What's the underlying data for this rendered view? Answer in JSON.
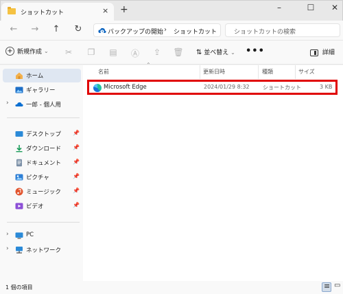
{
  "window": {
    "tab_title": "ショットカット",
    "close_tab_glyph": "×",
    "new_tab_glyph": "+",
    "minimize_glyph": "–",
    "maximize_glyph": "☐",
    "close_glyph": "✕"
  },
  "nav": {
    "back_glyph": "←",
    "forward_glyph": "→",
    "up_glyph": "↑",
    "refresh_glyph": "↻",
    "breadcrumbs": [
      "バックアップの開始",
      "ショットカット"
    ],
    "search_placeholder": "ショットカットの検索"
  },
  "toolbar": {
    "new_label": "新規作成",
    "sort_label": "並べ替え",
    "more_glyph": "•••",
    "details_label": "詳細"
  },
  "sidebar": {
    "items": [
      {
        "label": "ホーム",
        "icon": "home-icon"
      },
      {
        "label": "ギャラリー",
        "icon": "gallery-icon"
      },
      {
        "label": "一郎 - 個人用",
        "icon": "onedrive-icon"
      },
      {
        "label": "デスクトップ",
        "icon": "desktop-icon"
      },
      {
        "label": "ダウンロード",
        "icon": "download-icon"
      },
      {
        "label": "ドキュメント",
        "icon": "document-icon"
      },
      {
        "label": "ピクチャ",
        "icon": "pictures-icon"
      },
      {
        "label": "ミュージック",
        "icon": "music-icon"
      },
      {
        "label": "ビデオ",
        "icon": "video-icon"
      },
      {
        "label": "PC",
        "icon": "pc-icon"
      },
      {
        "label": "ネットワーク",
        "icon": "network-icon"
      }
    ]
  },
  "table": {
    "columns": [
      "名前",
      "更新日時",
      "種類",
      "サイズ"
    ],
    "rows": [
      {
        "name": "Microsoft Edge",
        "modified": "2024/01/29 8:32",
        "type": "ショートカット",
        "size": "3 KB"
      }
    ]
  },
  "status": {
    "item_count": "1 個の項目"
  },
  "colors": {
    "accent": "#0067c0",
    "highlight_border": "#e00000",
    "folder": "#f5c242"
  }
}
